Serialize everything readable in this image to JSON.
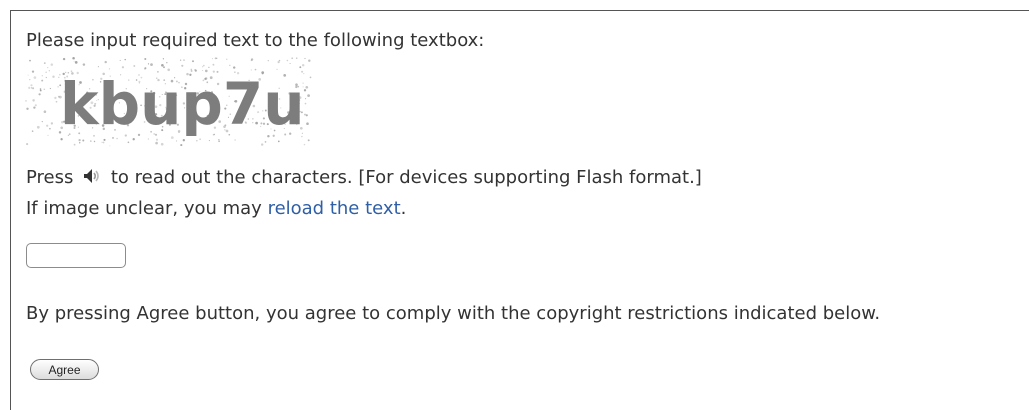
{
  "form": {
    "prompt": "Please input required text to the following textbox:",
    "captcha_text": "kbup7u",
    "audio_line_prefix": "Press",
    "speaker_icon": "speaker-icon",
    "audio_line_suffix": "to read out the characters. [For devices supporting Flash format.]",
    "reload_line_prefix": "If image unclear, you may",
    "reload_link": "reload the text",
    "reload_line_suffix": ".",
    "input_value": "",
    "agreement_text": "By pressing Agree button, you agree to comply with the copyright restrictions indicated below.",
    "agree_button": "Agree"
  },
  "colors": {
    "text": "#333333",
    "link": "#2f5fa6",
    "captcha_glyphs": "#7d7d7d",
    "border": "#555555"
  }
}
